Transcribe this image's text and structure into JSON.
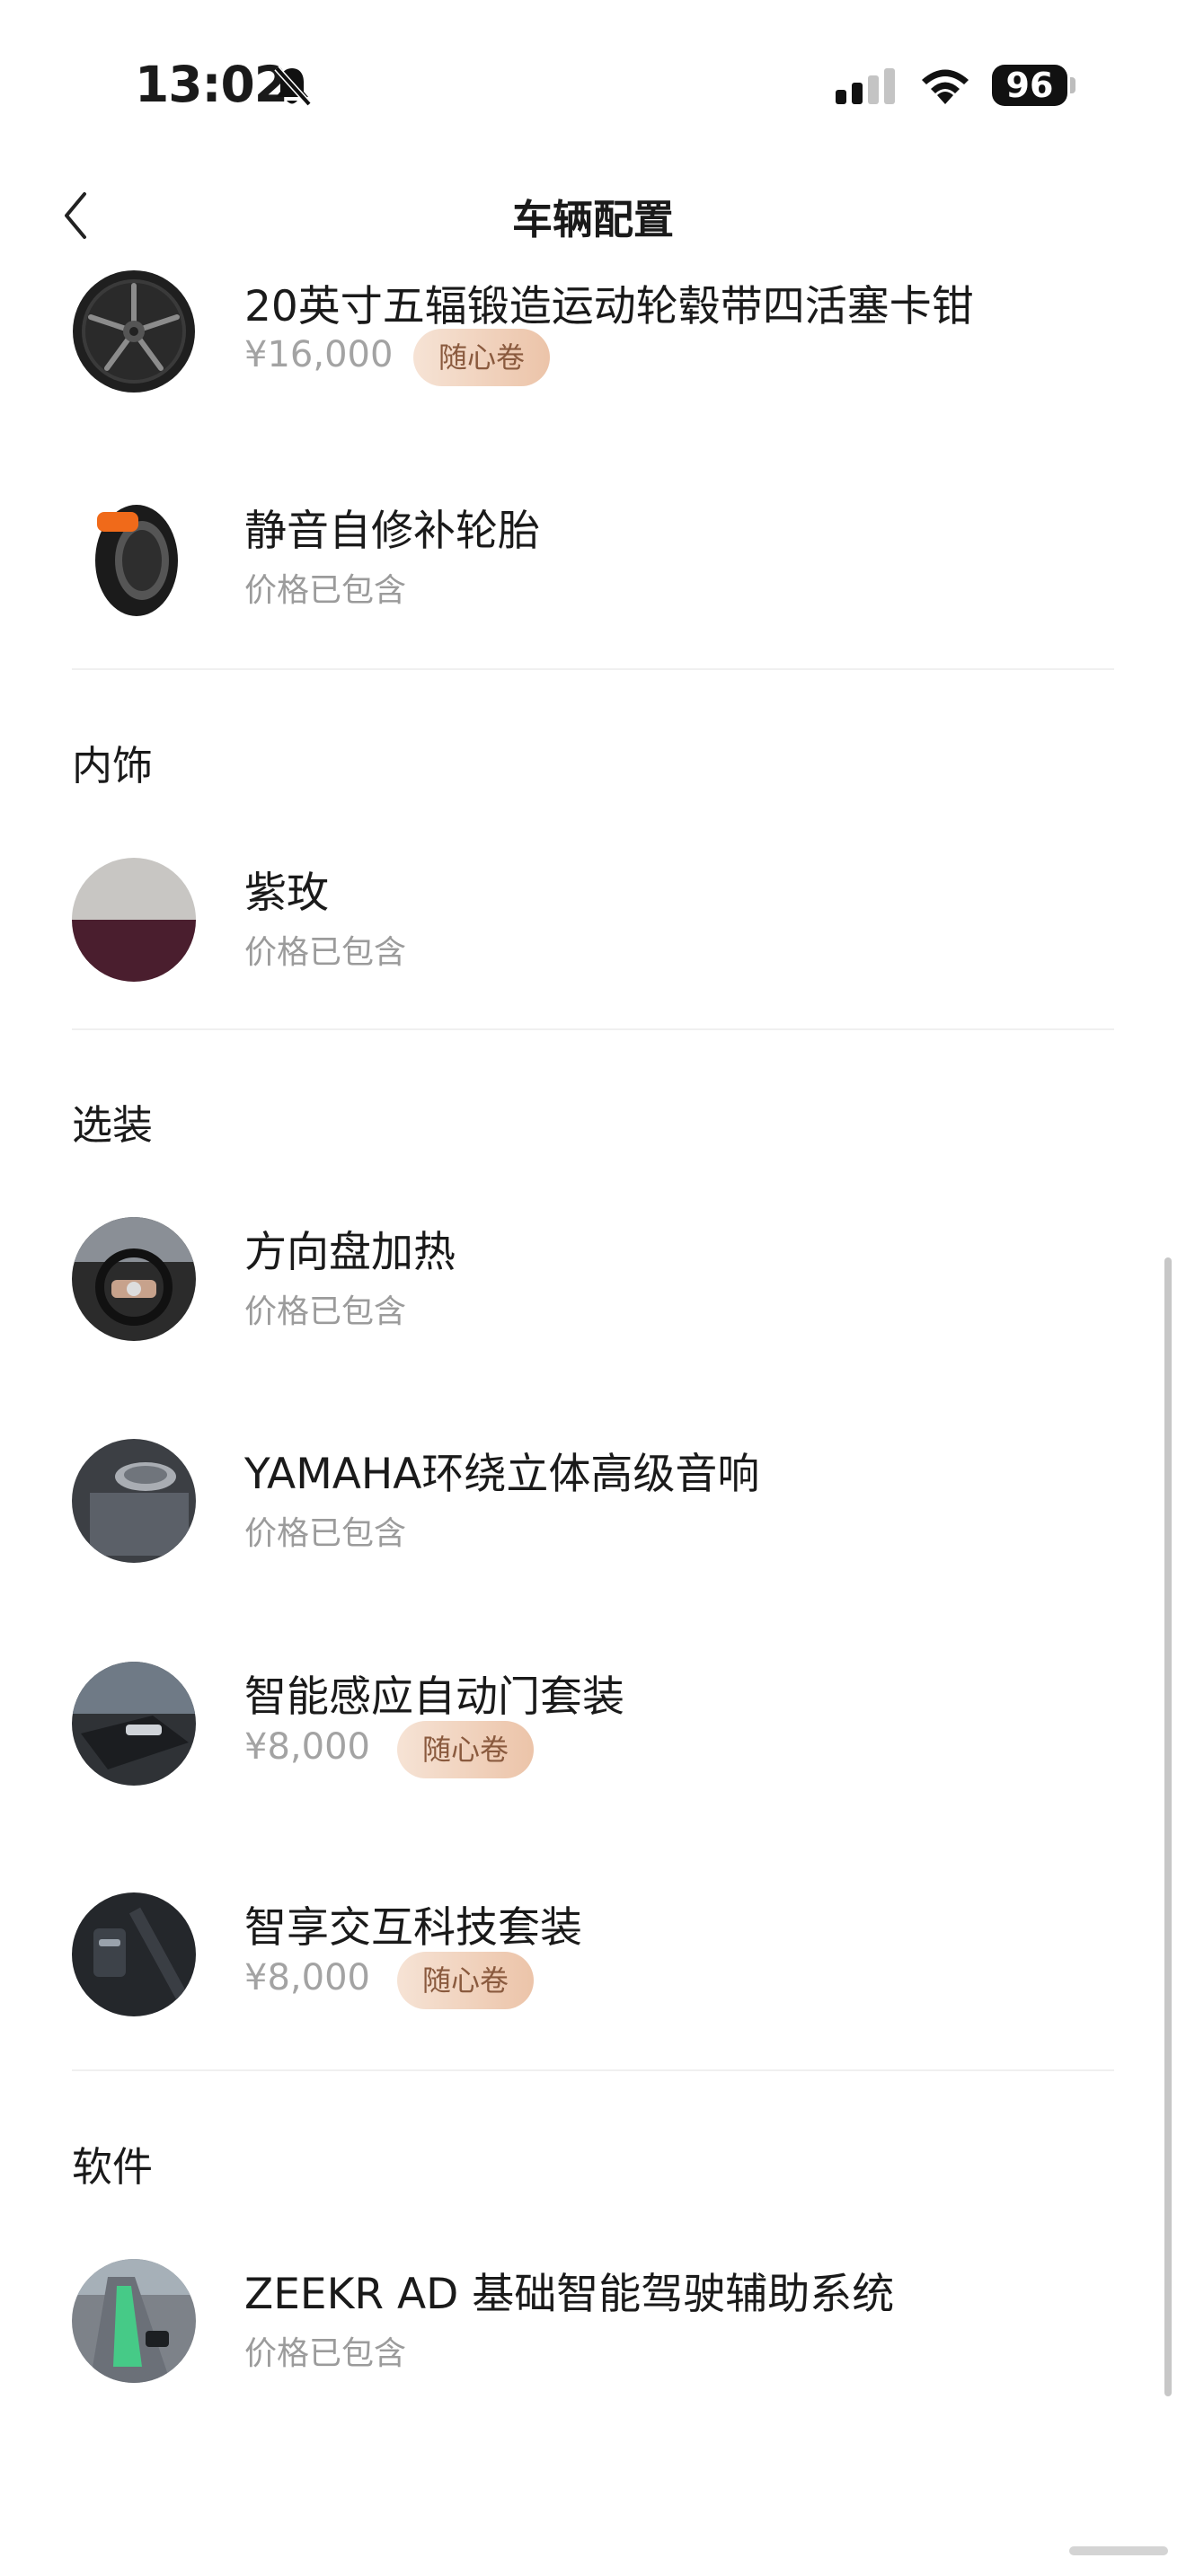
{
  "status": {
    "time": "13:02",
    "battery": "96"
  },
  "header": {
    "title": "车辆配置"
  },
  "wheels": [
    {
      "title": "20英寸五辐锻造运动轮毂带四活塞卡钳",
      "price": "¥16,000",
      "badge": "随心卷"
    },
    {
      "title": "静音自修补轮胎",
      "note": "价格已包含"
    }
  ],
  "interior": {
    "heading": "内饰",
    "items": [
      {
        "title": "紫玫",
        "note": "价格已包含"
      }
    ]
  },
  "options": {
    "heading": "选装",
    "items": [
      {
        "title": "方向盘加热",
        "note": "价格已包含"
      },
      {
        "title": "YAMAHA环绕立体高级音响",
        "note": "价格已包含"
      },
      {
        "title": "智能感应自动门套装",
        "price": "¥8,000",
        "badge": "随心卷"
      },
      {
        "title": "智享交互科技套装",
        "price": "¥8,000",
        "badge": "随心卷"
      }
    ]
  },
  "software": {
    "heading": "软件",
    "items": [
      {
        "title": "ZEEKR AD 基础智能驾驶辅助系统",
        "note": "价格已包含"
      }
    ]
  }
}
